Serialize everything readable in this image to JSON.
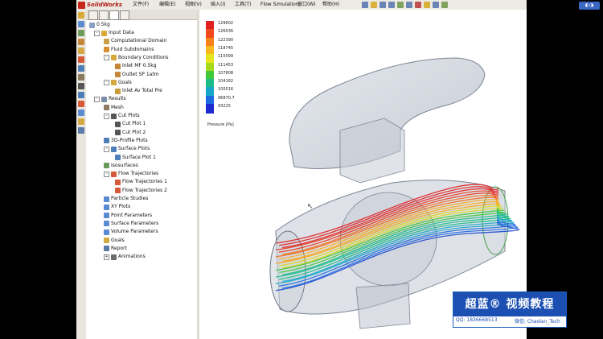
{
  "app": {
    "logo_text": "SolidWorks"
  },
  "menu": [
    "文件(F)",
    "编辑(E)",
    "视图(V)",
    "插入(I)",
    "工具(T)",
    "Flow Simulation",
    "窗口(W)",
    "帮助(H)"
  ],
  "tree": {
    "root": "0.5kg",
    "items": [
      {
        "label": "Input Data",
        "level": 1,
        "expander": "-",
        "icon": "folder-icon",
        "color": "#d8a838"
      },
      {
        "label": "Computational Domain",
        "level": 2,
        "icon": "domain-icon",
        "color": "#c9a043"
      },
      {
        "label": "Fluid Subdomains",
        "level": 2,
        "icon": "fluid-icon",
        "color": "#d58f2e"
      },
      {
        "label": "Boundary Conditions",
        "level": 2,
        "expander": "-",
        "icon": "boundary-icon",
        "color": "#d8a838"
      },
      {
        "label": "Inlet MF 0.5kg",
        "level": 3,
        "icon": "inlet-icon",
        "color": "#c4873a"
      },
      {
        "label": "Outlet SP 1atm",
        "level": 3,
        "icon": "outlet-icon",
        "color": "#c4873a"
      },
      {
        "label": "Goals",
        "level": 2,
        "expander": "-",
        "icon": "goals-icon",
        "color": "#d4a843"
      },
      {
        "label": "Inlet  Av Total Pre",
        "level": 3,
        "icon": "goal-item-icon",
        "color": "#c79a3b"
      },
      {
        "label": "Results",
        "level": 1,
        "expander": "-",
        "icon": "results-icon",
        "color": "#7f8ea8"
      },
      {
        "label": "Mesh",
        "level": 2,
        "icon": "mesh-icon",
        "color": "#8c7a60"
      },
      {
        "label": "Cut Plots",
        "level": 2,
        "expander": "-",
        "icon": "cut-plots-icon",
        "color": "#555555"
      },
      {
        "label": "Cut Plot 1",
        "level": 3,
        "icon": "cut-plot-icon",
        "color": "#555555"
      },
      {
        "label": "Cut Plot 2",
        "level": 3,
        "icon": "cut-plot-icon",
        "color": "#555555"
      },
      {
        "label": "3D-Profile Plots",
        "level": 2,
        "icon": "profile-plot-icon",
        "color": "#4f7fb8"
      },
      {
        "label": "Surface Plots",
        "level": 2,
        "expander": "-",
        "icon": "surface-plots-icon",
        "color": "#4f7fb8"
      },
      {
        "label": "Surface Plot 1",
        "level": 3,
        "icon": "surface-plot-icon",
        "color": "#4f7fb8"
      },
      {
        "label": "Isosurfaces",
        "level": 2,
        "icon": "isosurface-icon",
        "color": "#6b9a5a"
      },
      {
        "label": "Flow Trajectories",
        "level": 2,
        "expander": "-",
        "icon": "flow-trajectories-icon",
        "color": "#d65a3a"
      },
      {
        "label": "Flow Trajectories 1",
        "level": 3,
        "icon": "trajectory-icon",
        "color": "#d65a3a"
      },
      {
        "label": "Flow Trajectories 2",
        "level": 3,
        "icon": "trajectory-icon",
        "color": "#d65a3a"
      },
      {
        "label": "Particle Studies",
        "level": 2,
        "icon": "particle-icon",
        "color": "#5a8ad0"
      },
      {
        "label": "XY Plots",
        "level": 2,
        "icon": "xy-plot-icon",
        "color": "#5a8ad0"
      },
      {
        "label": "Point Parameters",
        "level": 2,
        "icon": "point-param-icon",
        "color": "#5a8ad0"
      },
      {
        "label": "Surface Parameters",
        "level": 2,
        "icon": "surface-param-icon",
        "color": "#5a8ad0"
      },
      {
        "label": "Volume Parameters",
        "level": 2,
        "icon": "volume-param-icon",
        "color": "#5a8ad0"
      },
      {
        "label": "Goals",
        "level": 2,
        "icon": "goals-result-icon",
        "color": "#d4a843"
      },
      {
        "label": "Report",
        "level": 2,
        "icon": "report-icon",
        "color": "#5a7aa8"
      },
      {
        "label": "Animations",
        "level": 2,
        "expander": "+",
        "icon": "animation-icon",
        "color": "#6b6b6b"
      }
    ]
  },
  "legend": {
    "values": [
      "129602",
      "126036",
      "122390",
      "118745",
      "115099",
      "111453",
      "107808",
      "104162",
      "100516",
      "96870.7",
      "93225"
    ],
    "colors": [
      "#e02020",
      "#f04a1c",
      "#f8821a",
      "#f6b81a",
      "#e8e41c",
      "#a6d81e",
      "#3ec83a",
      "#1abc8a",
      "#18a6c8",
      "#1c6ae0",
      "#1c2ad0"
    ],
    "unit": "Pressure [Pa]"
  },
  "watermark": {
    "title": "超蓝® 视频教程",
    "qq": "QQ: 1836668513",
    "wechat": "微信: Chaolan_Tech"
  }
}
